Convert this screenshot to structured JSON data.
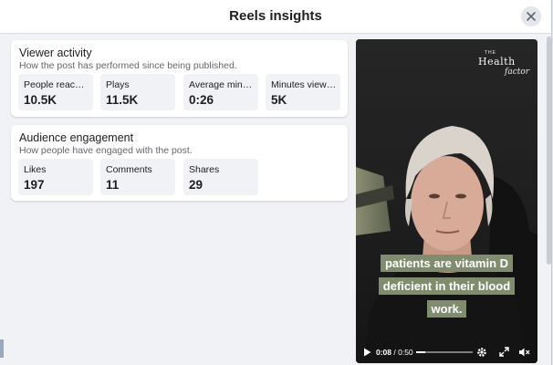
{
  "header": {
    "title": "Reels insights"
  },
  "viewer_activity": {
    "title": "Viewer activity",
    "subtitle": "How the post has performed since being published.",
    "metrics": [
      {
        "label": "People reached",
        "value": "10.5K"
      },
      {
        "label": "Plays",
        "value": "11.5K"
      },
      {
        "label": "Average minutes viewed",
        "value": "0:26"
      },
      {
        "label": "Minutes viewed",
        "value": "5K"
      }
    ]
  },
  "audience_engagement": {
    "title": "Audience engagement",
    "subtitle": "How people have engaged with the post.",
    "metrics": [
      {
        "label": "Likes",
        "value": "197"
      },
      {
        "label": "Comments",
        "value": "11"
      },
      {
        "label": "Shares",
        "value": "29"
      }
    ]
  },
  "video": {
    "logo": {
      "the": "THE",
      "health": "Health",
      "factor": "factor"
    },
    "captions": [
      "patients are vitamin D",
      "deficient in their blood",
      "work."
    ],
    "current_time": "0:08",
    "separator": " / ",
    "duration": "0:50",
    "progress_fraction": 0.16
  },
  "icons": {
    "close": "close-icon",
    "play": "play-icon",
    "settings": "gear-icon",
    "fullscreen": "expand-icon",
    "volume": "mute-icon"
  },
  "colors": {
    "caption_bg": "#7f8c6e",
    "panel_bg": "#f0f2f5",
    "card_bg": "#ffffff"
  }
}
